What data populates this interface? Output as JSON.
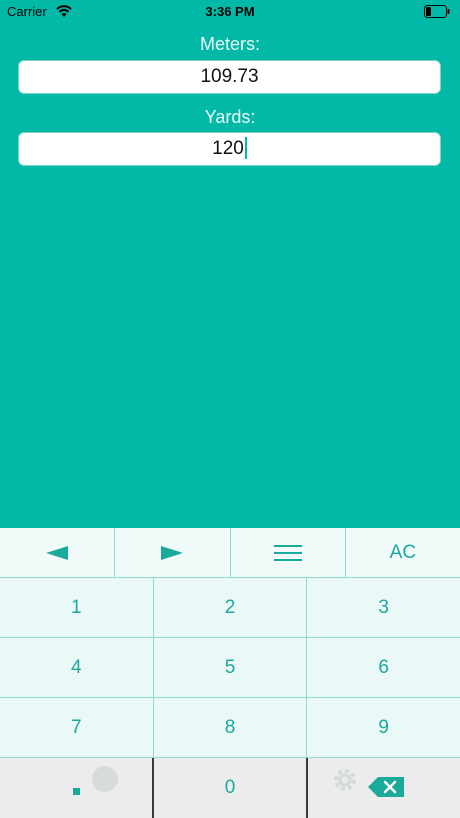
{
  "status_bar": {
    "carrier": "Carrier",
    "time": "3:36 PM"
  },
  "converter": {
    "meters_label": "Meters:",
    "meters_value": "109.73",
    "yards_label": "Yards:",
    "yards_value": "120"
  },
  "keyboard": {
    "top_row": {
      "left_icon": "left-arrow-icon",
      "right_icon": "right-arrow-icon",
      "menu_icon": "menu-icon",
      "clear_label": "AC"
    },
    "digits": [
      "1",
      "2",
      "3",
      "4",
      "5",
      "6",
      "7",
      "8",
      "9"
    ],
    "decimal_label": ".",
    "zero_label": "0",
    "backspace_icon": "backspace-icon"
  },
  "colors": {
    "background": "#02b8a6",
    "key_text": "#1ba99b",
    "key_background": "#eaf8f7",
    "divider": "#8fdad1"
  }
}
